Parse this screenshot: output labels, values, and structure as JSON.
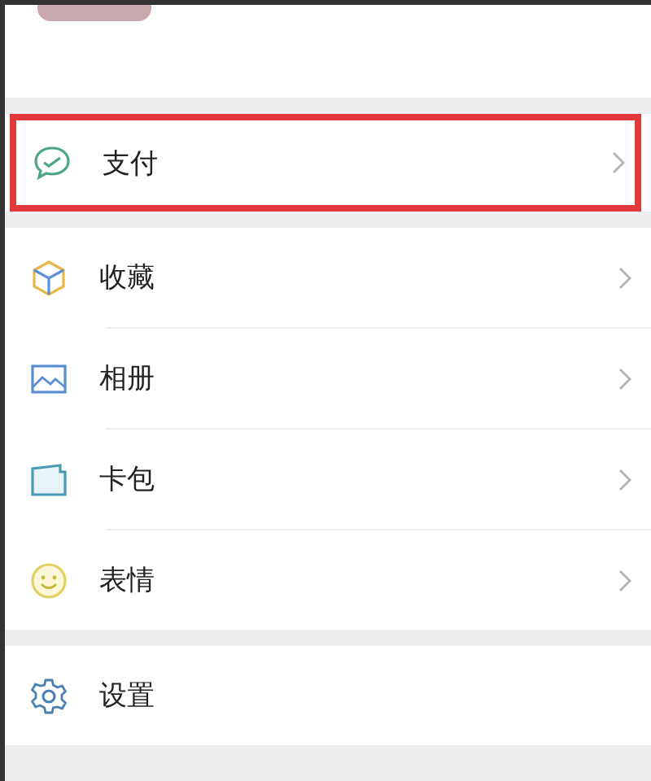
{
  "sections": [
    {
      "items": [
        {
          "kind": "pay",
          "label": "支付",
          "highlighted": true,
          "chevron": true
        }
      ]
    },
    {
      "items": [
        {
          "kind": "favorites",
          "label": "收藏",
          "highlighted": false,
          "chevron": true
        },
        {
          "kind": "album",
          "label": "相册",
          "highlighted": false,
          "chevron": true
        },
        {
          "kind": "cards",
          "label": "卡包",
          "highlighted": false,
          "chevron": true
        },
        {
          "kind": "stickers",
          "label": "表情",
          "highlighted": false,
          "chevron": true
        }
      ]
    },
    {
      "items": [
        {
          "kind": "settings",
          "label": "设置",
          "highlighted": false,
          "chevron": false
        }
      ]
    }
  ]
}
